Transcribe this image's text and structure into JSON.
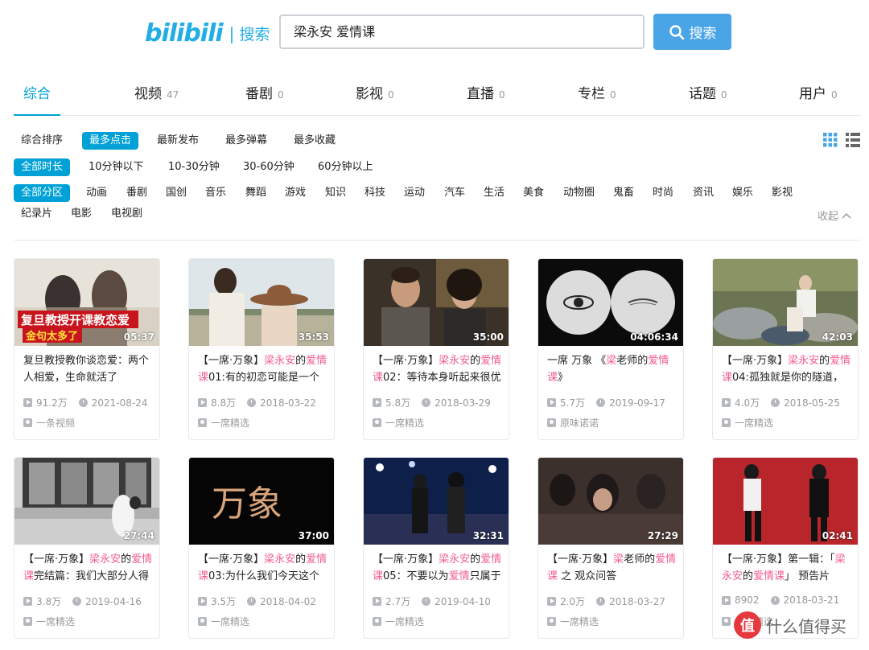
{
  "header": {
    "logo_mark": "bilibili",
    "logo_sep": "|",
    "logo_text": "搜索",
    "search_value": "梁永安 爱情课",
    "search_button": "搜索"
  },
  "tabs": [
    {
      "label": "综合",
      "count": ""
    },
    {
      "label": "视频",
      "count": "47"
    },
    {
      "label": "番剧",
      "count": "0"
    },
    {
      "label": "影视",
      "count": "0"
    },
    {
      "label": "直播",
      "count": "0"
    },
    {
      "label": "专栏",
      "count": "0"
    },
    {
      "label": "话题",
      "count": "0"
    },
    {
      "label": "用户",
      "count": "0"
    }
  ],
  "sort_options": [
    "综合排序",
    "最多点击",
    "最新发布",
    "最多弹幕",
    "最多收藏"
  ],
  "duration_options": [
    "全部时长",
    "10分钟以下",
    "10-30分钟",
    "30-60分钟",
    "60分钟以上"
  ],
  "zone_options": [
    "全部分区",
    "动画",
    "番剧",
    "国创",
    "音乐",
    "舞蹈",
    "游戏",
    "知识",
    "科技",
    "运动",
    "汽车",
    "生活",
    "美食",
    "动物圈",
    "鬼畜",
    "时尚",
    "资讯",
    "娱乐",
    "影视"
  ],
  "zone_options_row2": [
    "纪录片",
    "电影",
    "电视剧"
  ],
  "collapse_label": "收起",
  "videos": [
    {
      "duration": "05:37",
      "thumb_caption1": "复旦教授开课教恋爱",
      "thumb_caption2": "金句太多了",
      "title": [
        {
          "t": "复旦教授教你谈恋爱：两个人相爱，生命就活了",
          "h": false
        }
      ],
      "plays": "91.2万",
      "date": "2021-08-24",
      "uploader": "一条视频"
    },
    {
      "duration": "35:53",
      "title": [
        {
          "t": "【一席·万象】",
          "h": false
        },
        {
          "t": "梁永安",
          "h": true
        },
        {
          "t": "的",
          "h": false
        },
        {
          "t": "爱情课",
          "h": true
        },
        {
          "t": "01:有的初恋可能是一个",
          "h": false
        }
      ],
      "plays": "8.8万",
      "date": "2018-03-22",
      "uploader": "一席精选"
    },
    {
      "duration": "35:00",
      "title": [
        {
          "t": "【一席·万象】",
          "h": false
        },
        {
          "t": "梁永安",
          "h": true
        },
        {
          "t": "的",
          "h": false
        },
        {
          "t": "爱情课",
          "h": true
        },
        {
          "t": "02：等待本身听起来很优",
          "h": false
        }
      ],
      "plays": "5.8万",
      "date": "2018-03-29",
      "uploader": "一席精选"
    },
    {
      "duration": "04:06:34",
      "title": [
        {
          "t": "一席 万象 《",
          "h": false
        },
        {
          "t": "梁",
          "h": true
        },
        {
          "t": "老师的",
          "h": false
        },
        {
          "t": "爱情课",
          "h": true
        },
        {
          "t": "》",
          "h": false
        }
      ],
      "plays": "5.7万",
      "date": "2019-09-17",
      "uploader": "原味诺诺"
    },
    {
      "duration": "42:03",
      "title": [
        {
          "t": "【一席·万象】",
          "h": false
        },
        {
          "t": "梁永安",
          "h": true
        },
        {
          "t": "的",
          "h": false
        },
        {
          "t": "爱情课",
          "h": true
        },
        {
          "t": "04:孤独就是你的隧道，",
          "h": false
        }
      ],
      "plays": "4.0万",
      "date": "2018-05-25",
      "uploader": "一席精选"
    },
    {
      "duration": "27:44",
      "title": [
        {
          "t": "【一席·万象】",
          "h": false
        },
        {
          "t": "梁永安",
          "h": true
        },
        {
          "t": "的",
          "h": false
        },
        {
          "t": "爱情课",
          "h": true
        },
        {
          "t": "完结篇：我们大部分人得",
          "h": false
        }
      ],
      "plays": "3.8万",
      "date": "2019-04-16",
      "uploader": "一席精选"
    },
    {
      "duration": "37:00",
      "thumb_caption1": "万象",
      "title": [
        {
          "t": "【一席·万象】",
          "h": false
        },
        {
          "t": "梁永安",
          "h": true
        },
        {
          "t": "的",
          "h": false
        },
        {
          "t": "爱情课",
          "h": true
        },
        {
          "t": "03:为什么我们今天这个",
          "h": false
        }
      ],
      "plays": "3.5万",
      "date": "2018-04-02",
      "uploader": "一席精选"
    },
    {
      "duration": "32:31",
      "title": [
        {
          "t": "【一席·万象】",
          "h": false
        },
        {
          "t": "梁永安",
          "h": true
        },
        {
          "t": "的",
          "h": false
        },
        {
          "t": "爱情课",
          "h": true
        },
        {
          "t": "05：不要以为",
          "h": false
        },
        {
          "t": "爱情",
          "h": true
        },
        {
          "t": "只属于",
          "h": false
        }
      ],
      "plays": "2.7万",
      "date": "2019-04-10",
      "uploader": "一席精选"
    },
    {
      "duration": "27:29",
      "title": [
        {
          "t": "【一席·万象】",
          "h": false
        },
        {
          "t": "梁",
          "h": true
        },
        {
          "t": "老师的",
          "h": false
        },
        {
          "t": "爱情课",
          "h": true
        },
        {
          "t": " 之 观众问答",
          "h": false
        }
      ],
      "plays": "2.0万",
      "date": "2018-03-27",
      "uploader": "一席精选"
    },
    {
      "duration": "02:41",
      "title": [
        {
          "t": "【一席·万象】第一辑：「",
          "h": false
        },
        {
          "t": "梁永安",
          "h": true
        },
        {
          "t": "的",
          "h": false
        },
        {
          "t": "爱情课",
          "h": true
        },
        {
          "t": "」 预告片",
          "h": false
        }
      ],
      "plays": "8902",
      "date": "2018-03-21",
      "uploader": "一席精选"
    }
  ],
  "watermark": {
    "logo": "值",
    "text": "什么值得买"
  },
  "colors": {
    "accent": "#00a1d6",
    "highlight": "#f25d8e",
    "search_button": "#4aa5e6"
  }
}
